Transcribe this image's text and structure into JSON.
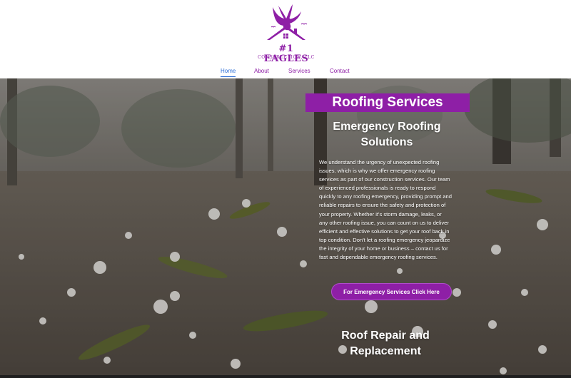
{
  "logo": {
    "title": "#1 EAGLES",
    "subtitle": "CONSTRUCTION, LLC"
  },
  "nav": {
    "items": [
      "Home",
      "About",
      "Services",
      "Contact"
    ],
    "active": "Home"
  },
  "hero": {
    "banner": "Roofing Services",
    "heading": "Emergency Roofing Solutions",
    "body": "We understand the urgency of unexpected roofing issues, which is why we offer emergency roofing services as part of our construction services. Our team of experienced professionals is ready to respond quickly to any roofing emergency, providing prompt and reliable repairs to ensure the safety and protection of your property. Whether it's storm damage, leaks, or any other roofing issue, you can count on us to deliver efficient and effective solutions to get your roof back in top condition. Don't let a roofing emergency jeopardize the integrity of your home or business – contact us for fast and dependable emergency roofing services.",
    "cta": "For Emergency Services Click Here",
    "next_heading": "Roof Repair and Replacement"
  },
  "colors": {
    "brand_purple": "#8e1fa6",
    "nav_active": "#2f6fd6",
    "header_bg": "#ffffff"
  },
  "icons": {
    "logo_mark": "eagle-over-roof-icon"
  }
}
